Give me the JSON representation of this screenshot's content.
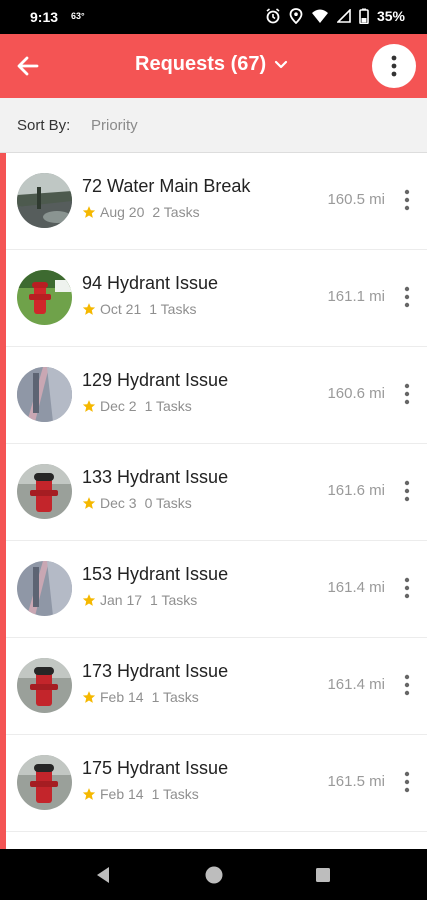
{
  "status_bar": {
    "time": "9:13",
    "temperature": "63°",
    "battery": "35%",
    "icons": [
      "alarm-icon",
      "location-icon",
      "wifi-icon",
      "signal-icon",
      "battery-icon"
    ]
  },
  "app_bar": {
    "title": "Requests (67)",
    "color": "#f45454"
  },
  "sort": {
    "label": "Sort By:",
    "value": "Priority"
  },
  "requests": [
    {
      "title": "72 Water Main Break",
      "date": "Aug 20",
      "tasks": "2 Tasks",
      "distance": "160.5 mi",
      "thumb": "street"
    },
    {
      "title": "94 Hydrant Issue",
      "date": "Oct 21",
      "tasks": "1 Tasks",
      "distance": "161.1 mi",
      "thumb": "grass-hydrant"
    },
    {
      "title": "129 Hydrant Issue",
      "date": "Dec 2",
      "tasks": "1 Tasks",
      "distance": "160.6 mi",
      "thumb": "pole"
    },
    {
      "title": "133 Hydrant Issue",
      "date": "Dec 3",
      "tasks": "0 Tasks",
      "distance": "161.6 mi",
      "thumb": "hydrant"
    },
    {
      "title": "153 Hydrant Issue",
      "date": "Jan 17",
      "tasks": "1 Tasks",
      "distance": "161.4 mi",
      "thumb": "pole"
    },
    {
      "title": "173 Hydrant Issue",
      "date": "Feb 14",
      "tasks": "1 Tasks",
      "distance": "161.4 mi",
      "thumb": "hydrant"
    },
    {
      "title": "175 Hydrant Issue",
      "date": "Feb 14",
      "tasks": "1 Tasks",
      "distance": "161.5 mi",
      "thumb": "hydrant"
    }
  ],
  "colors": {
    "accent": "#f45454",
    "star": "#f5b800"
  }
}
